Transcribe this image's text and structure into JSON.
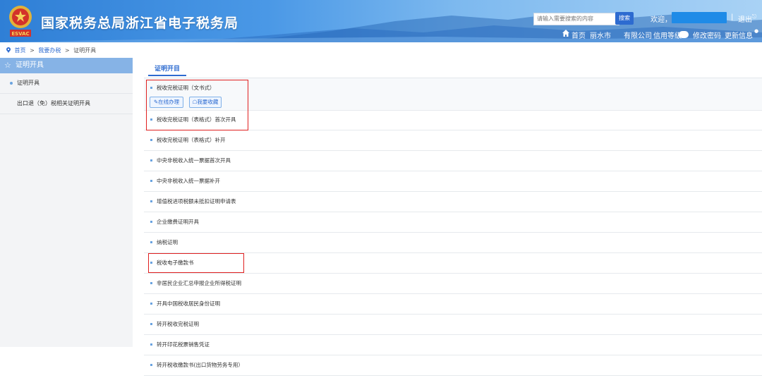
{
  "header": {
    "title": "国家税务总局浙江省电子税务局",
    "emblem_text": "ESVAC",
    "search_placeholder": "请输入需要搜索的内容",
    "search_button": "搜索",
    "welcome": "欢迎，",
    "separator": "|",
    "logout": "退出",
    "home": "首页",
    "city": "丽水市",
    "company": "有限公司",
    "credit": "信用等级",
    "change_password": "修改密码",
    "update_info": "更新信息"
  },
  "breadcrumb": {
    "items": [
      "首页",
      ">",
      "我要办税",
      ">",
      "证明开具"
    ]
  },
  "sidebar": {
    "heading": "证明开具",
    "items": [
      {
        "label": "证明开具"
      },
      {
        "label": "出口退（免）税相关证明开具"
      }
    ]
  },
  "main": {
    "tab": "证明开目",
    "items": [
      {
        "label": "税收完税证明（文书式）"
      },
      {
        "label": "税收完税证明（表格式）首次开具"
      },
      {
        "label": "税收完税证明（表格式）补开"
      },
      {
        "label": "中央非税收入统一票据首次开具"
      },
      {
        "label": "中央非税收入统一票据补开"
      },
      {
        "label": "增值税进项税额未抵扣证明申请表"
      },
      {
        "label": "企业缴费证明开具"
      },
      {
        "label": "纳税证明"
      },
      {
        "label": "税收电子缴款书"
      },
      {
        "label": "非居民企业汇总申报企业所得税证明"
      },
      {
        "label": "开具中国税收居民身份证明"
      },
      {
        "label": "转开税收完税证明"
      },
      {
        "label": "转开印花税票销售凭证"
      },
      {
        "label": "转开税收缴款书(出口货物劳务专用）"
      }
    ],
    "actions": {
      "online": "在线办理",
      "favorite": "我要收藏"
    }
  },
  "colors": {
    "primary": "#2d6bd0",
    "header_start": "#2f7fd6",
    "sidebar_head": "#86b3e6",
    "highlight_red": "#e02020"
  }
}
